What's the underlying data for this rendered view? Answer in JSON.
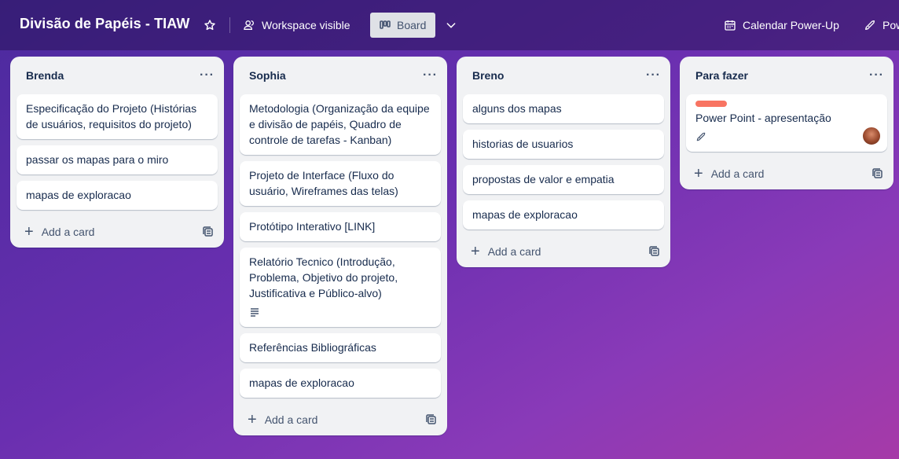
{
  "header": {
    "board_title": "Divisão de Papéis - TIAW",
    "star_icon": "star-icon",
    "visibility_label": "Workspace visible",
    "view_label": "Board",
    "calendar_label": "Calendar Power-Up",
    "powerups_label": "Pow"
  },
  "lists": [
    {
      "title": "Brenda",
      "cards": [
        {
          "text": "Especificação do Projeto (Histórias de usuários, requisitos do projeto)"
        },
        {
          "text": "passar os mapas para o miro"
        },
        {
          "text": "mapas de exploracao"
        }
      ],
      "add_label": "Add a card"
    },
    {
      "title": "Sophia",
      "cards": [
        {
          "text": "Metodologia (Organização da equipe e divisão de papéis, Quadro de controle de tarefas - Kanban)"
        },
        {
          "text": "Projeto de Interface (Fluxo do usuário, Wireframes das telas)"
        },
        {
          "text": "Protótipo Interativo [LINK]"
        },
        {
          "text": "Relatório Tecnico (Introdução, Problema, Objetivo do projeto, Justificativa e Público-alvo)"
        },
        {
          "text": "Referências Bibliográficas"
        },
        {
          "text": "mapas de exploracao"
        }
      ],
      "add_label": "Add a card"
    },
    {
      "title": "Breno",
      "cards": [
        {
          "text": "alguns dos mapas"
        },
        {
          "text": "historias de usuarios"
        },
        {
          "text": "propostas de valor e empatia"
        },
        {
          "text": "mapas de exploracao"
        }
      ],
      "add_label": "Add a card"
    },
    {
      "title": "Para fazer",
      "cards": [
        {
          "text": "Power Point - apresentação",
          "label_color": "#f87462"
        }
      ],
      "add_label": "Add a card"
    }
  ]
}
